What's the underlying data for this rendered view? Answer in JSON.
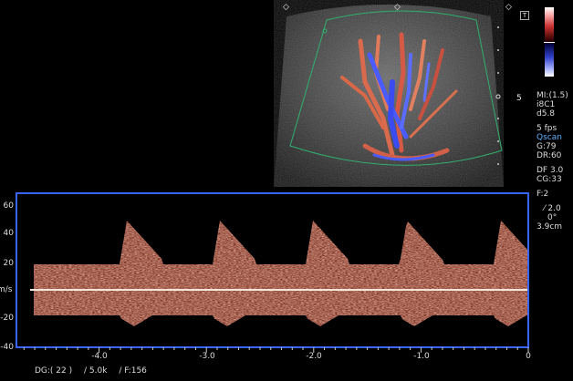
{
  "color_scale_label": "",
  "info_panel": {
    "mi": "MI:(1.5)",
    "probe": "i8C1",
    "depth": "d5.8",
    "fps": "5 fps",
    "scan_mode": "Qscan",
    "gain": "G:79",
    "dynamic_range": "DR:60",
    "df": "DF 3.0",
    "cg": "CG:33",
    "filter": "F:2",
    "angle_value": "2.0",
    "angle_deg": "0°",
    "gate_depth": "3.9cm"
  },
  "sector_depth_marker": "5",
  "spectrum": {
    "y_axis_labels": [
      "60",
      "40",
      "20",
      "m/s",
      "-20",
      "-40"
    ],
    "x_axis_labels": [
      "-4.0",
      "-3.0",
      "-2.0",
      "-1.0",
      "0"
    ]
  },
  "status_bar": {
    "dg": "DG:( 22 )",
    "prf": "/ 5.0k",
    "frame": "/ F:156"
  },
  "colors": {
    "spectrum_border": "#3a64ff",
    "doppler_red": "#e0735a",
    "doppler_blue": "#4a5cff",
    "scan_label_blue": "#5fb0ff"
  }
}
